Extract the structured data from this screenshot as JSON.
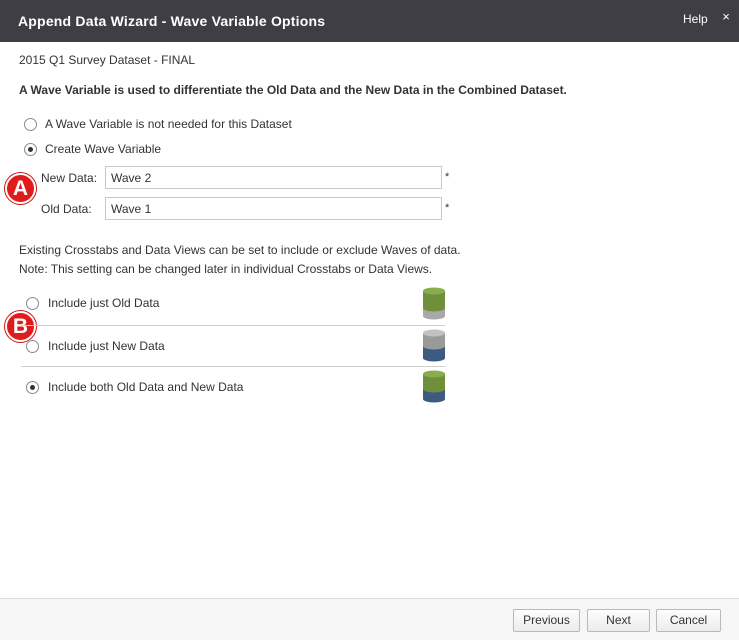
{
  "window": {
    "title": "Append Data Wizard - Wave Variable Options",
    "help_label": "Help",
    "close_glyph": "×"
  },
  "dataset_name": "2015 Q1 Survey Dataset - FINAL",
  "description": "A Wave Variable is used to differentiate the Old Data and the New Data in the Combined Dataset.",
  "wave_options": [
    {
      "label": "A Wave Variable is not needed for this Dataset",
      "selected": false
    },
    {
      "label": "Create Wave Variable",
      "selected": true
    }
  ],
  "fields": {
    "new_data": {
      "label": "New Data:",
      "value": "Wave 2",
      "required_mark": "*"
    },
    "old_data": {
      "label": "Old Data:",
      "value": "Wave 1",
      "required_mark": "*"
    }
  },
  "badges": {
    "a": "A",
    "b": "B"
  },
  "notes": {
    "line1": "Existing Crosstabs and Data Views can be set to include or exclude Waves of data.",
    "line2": "Note: This setting can be changed later in individual Crosstabs or Data Views."
  },
  "include_options": [
    {
      "label": "Include just Old Data",
      "selected": false,
      "icon": "database-old-data-icon"
    },
    {
      "label": "Include just New Data",
      "selected": false,
      "icon": "database-new-data-icon"
    },
    {
      "label": "Include both Old Data and New Data",
      "selected": true,
      "icon": "database-both-data-icon"
    }
  ],
  "colors": {
    "title_bar": "#3e3e44",
    "badge_red": "#e01b1b",
    "old_data_green": "#6f8f3a",
    "new_data_blue": "#3d5a80",
    "inactive_gray": "#a8a8a8"
  },
  "footer": {
    "previous_label": "Previous",
    "next_label": "Next",
    "cancel_label": "Cancel"
  }
}
